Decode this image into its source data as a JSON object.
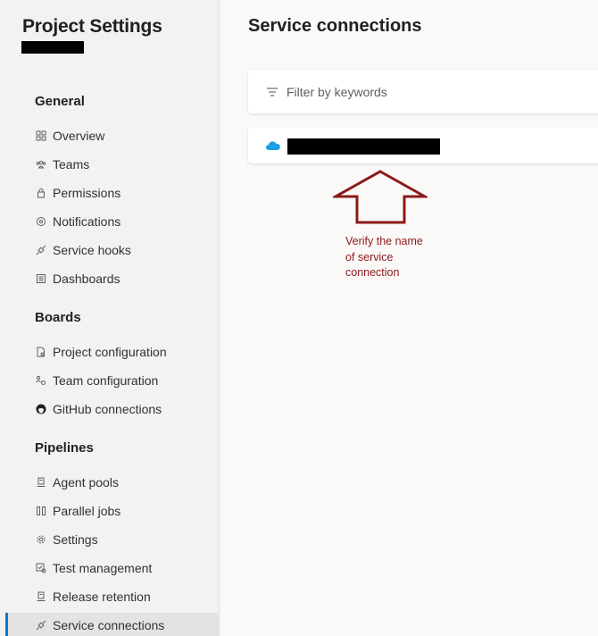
{
  "sidebar": {
    "title": "Project Settings",
    "sections": [
      {
        "header": "General",
        "items": [
          {
            "label": "Overview",
            "icon": "overview-icon"
          },
          {
            "label": "Teams",
            "icon": "teams-icon"
          },
          {
            "label": "Permissions",
            "icon": "lock-icon"
          },
          {
            "label": "Notifications",
            "icon": "notification-icon"
          },
          {
            "label": "Service hooks",
            "icon": "plug-icon"
          },
          {
            "label": "Dashboards",
            "icon": "dashboard-icon"
          }
        ]
      },
      {
        "header": "Boards",
        "items": [
          {
            "label": "Project configuration",
            "icon": "document-gear-icon"
          },
          {
            "label": "Team configuration",
            "icon": "team-gear-icon"
          },
          {
            "label": "GitHub connections",
            "icon": "github-icon"
          }
        ]
      },
      {
        "header": "Pipelines",
        "items": [
          {
            "label": "Agent pools",
            "icon": "agent-icon"
          },
          {
            "label": "Parallel jobs",
            "icon": "parallel-icon"
          },
          {
            "label": "Settings",
            "icon": "gear-icon"
          },
          {
            "label": "Test management",
            "icon": "test-icon"
          },
          {
            "label": "Release retention",
            "icon": "retention-icon"
          },
          {
            "label": "Service connections",
            "icon": "plug-icon",
            "selected": true
          }
        ]
      }
    ]
  },
  "main": {
    "title": "Service connections",
    "filter_placeholder": "Filter by keywords",
    "connection_icon": "cloud-icon",
    "annotation": {
      "line1": "Verify the name",
      "line2": "of service",
      "line3": "connection"
    }
  },
  "colors": {
    "accent": "#0078d4",
    "cloud": "#1ba1e2",
    "annotation": "#8b1a1a"
  }
}
